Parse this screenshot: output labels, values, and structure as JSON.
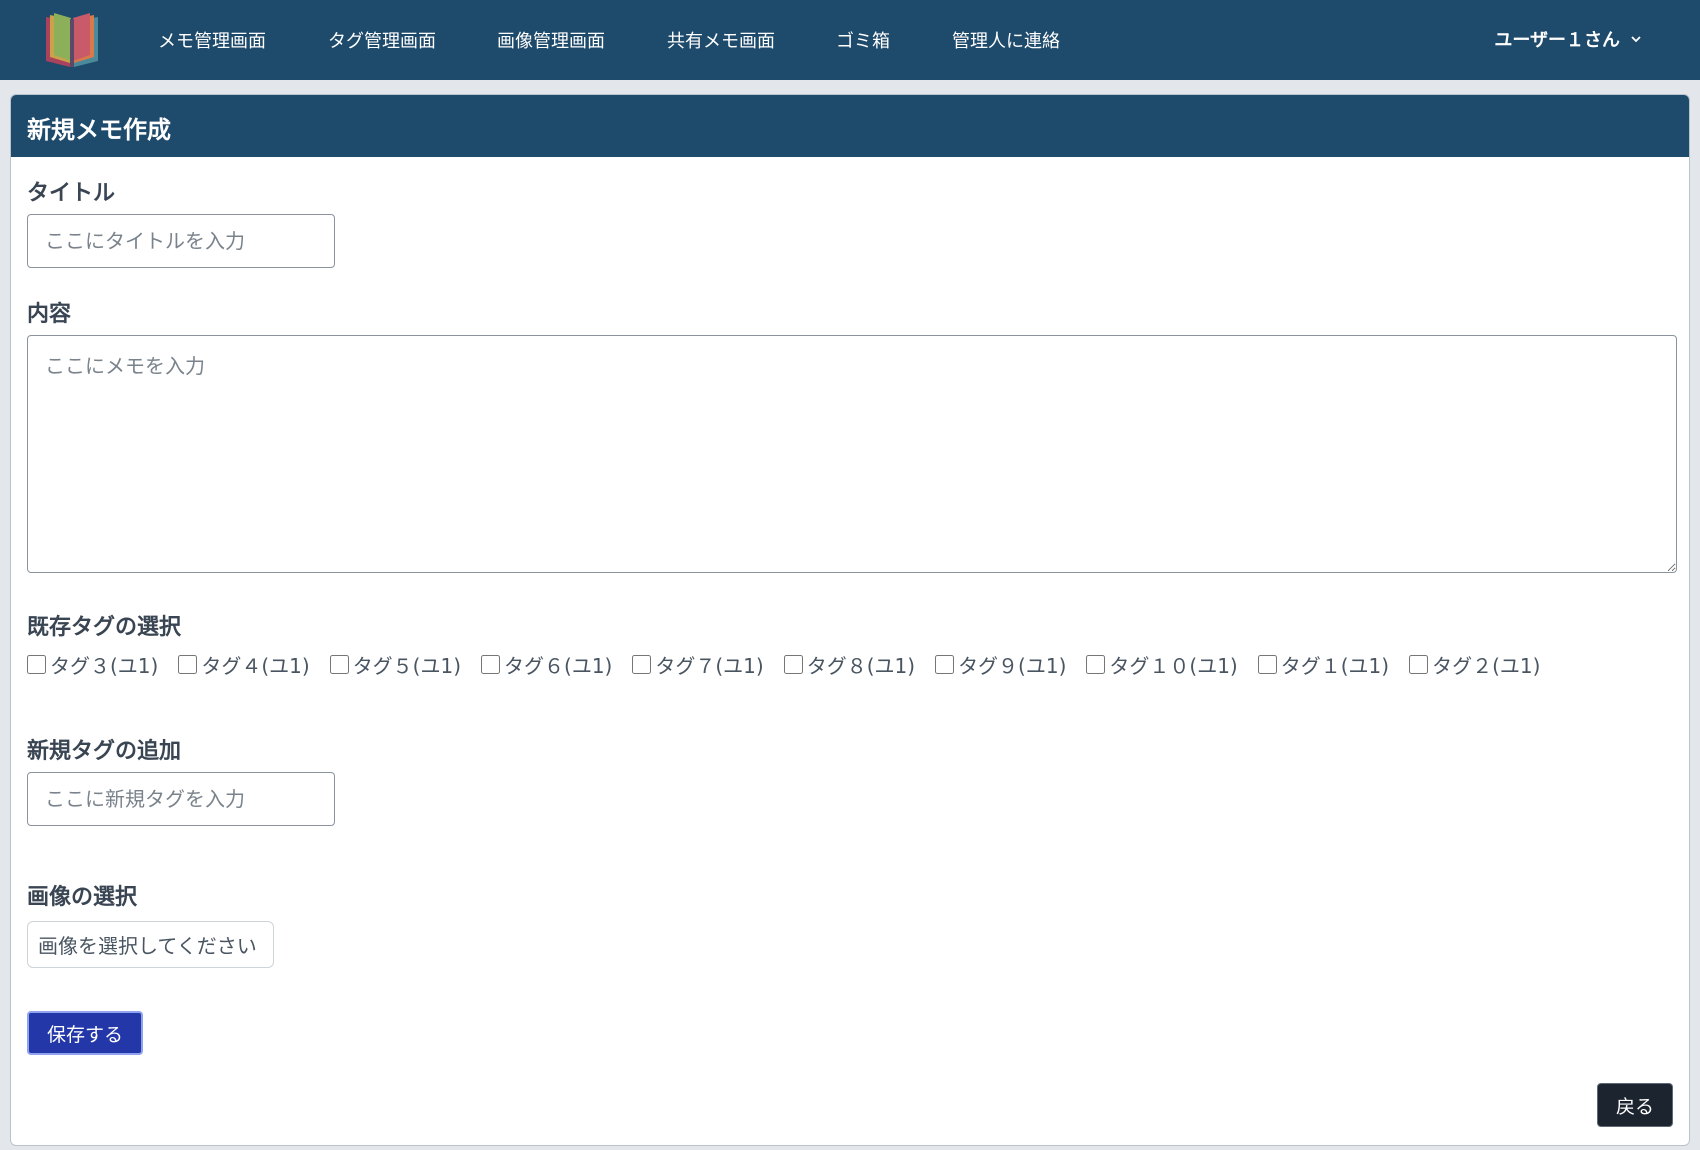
{
  "nav": {
    "items": [
      {
        "label": "メモ管理画面"
      },
      {
        "label": "タグ管理画面"
      },
      {
        "label": "画像管理画面"
      },
      {
        "label": "共有メモ画面"
      },
      {
        "label": "ゴミ箱"
      },
      {
        "label": "管理人に連絡"
      }
    ],
    "user": "ユーザー１さん"
  },
  "card": {
    "title": "新規メモ作成"
  },
  "form": {
    "title_label": "タイトル",
    "title_placeholder": "ここにタイトルを入力",
    "content_label": "内容",
    "content_placeholder": "ここにメモを入力",
    "existing_tags_label": "既存タグの選択",
    "tags": [
      {
        "label": "タグ３(ユ1)"
      },
      {
        "label": "タグ４(ユ1)"
      },
      {
        "label": "タグ５(ユ1)"
      },
      {
        "label": "タグ６(ユ1)"
      },
      {
        "label": "タグ７(ユ1)"
      },
      {
        "label": "タグ８(ユ1)"
      },
      {
        "label": "タグ９(ユ1)"
      },
      {
        "label": "タグ１０(ユ1)"
      },
      {
        "label": "タグ１(ユ1)"
      },
      {
        "label": "タグ２(ユ1)"
      }
    ],
    "new_tag_label": "新規タグの追加",
    "new_tag_placeholder": "ここに新規タグを入力",
    "image_label": "画像の選択",
    "image_button": "画像を選択してください",
    "save_button": "保存する",
    "back_button": "戻る"
  },
  "colors": {
    "navbar": "#1e4a6b",
    "save_button": "#2337a8",
    "back_button": "#1c2430"
  }
}
